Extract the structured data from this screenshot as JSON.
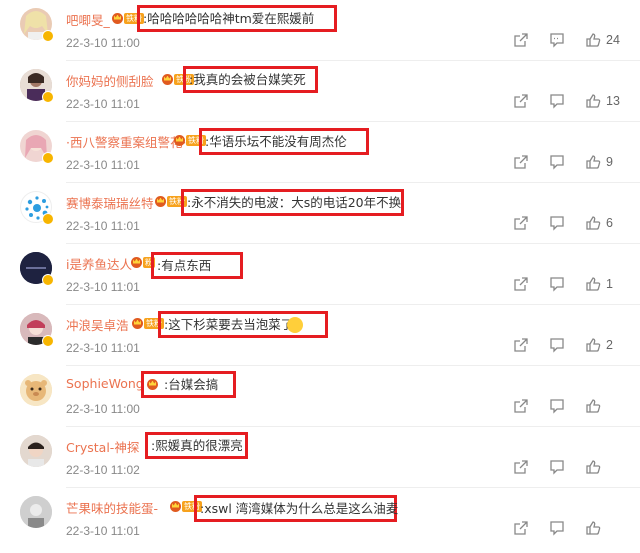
{
  "comments": [
    {
      "name": "吧唧旻_",
      "text": ":哈哈哈哈哈哈神tm爱在熙媛前",
      "time": "22-3-10 11:00",
      "likes": "24",
      "tag": "铁粉",
      "avatar_color": "#e9c2a6"
    },
    {
      "name": "你妈妈的侧刮脸",
      "text": ":我真的会被台媒笑死",
      "time": "22-3-10 11:01",
      "likes": "13",
      "tag": "铁粉",
      "avatar_color": "#b89a8a"
    },
    {
      "name": "·西八警察重案组警花·",
      "text": ":华语乐坛不能没有周杰伦",
      "time": "22-3-10 11:01",
      "likes": "9",
      "tag": "铁粉",
      "avatar_color": "#e7b3b0"
    },
    {
      "name": "赛博泰瑞瑞丝特",
      "text": ":永不消失的电波：大s的电话20年不换",
      "time": "22-3-10 11:01",
      "likes": "6",
      "tag": "铁粉",
      "avatar_color": "#ffffff"
    },
    {
      "name": "i是养鱼达人",
      "text": ":有点东西",
      "time": "22-3-10 11:01",
      "likes": "1",
      "tag": "粉",
      "avatar_color": "#1e2240"
    },
    {
      "name": "冲浪吴卓浩",
      "text": ":这下杉菜要去当泡菜了",
      "time": "22-3-10 11:01",
      "likes": "2",
      "tag": "铁粉",
      "avatar_color": "#c98a8e"
    },
    {
      "name": "SophieWong",
      "text": ":台媒会搞",
      "time": "22-3-10 11:00",
      "likes": "",
      "tag": "",
      "avatar_color": "#f2d9a6"
    },
    {
      "name": "Crystal-神探",
      "text": ":熙媛真的很漂亮",
      "time": "22-3-10 11:02",
      "likes": "",
      "tag": "",
      "avatar_color": "#d9c8bd"
    },
    {
      "name": "芒果味的技能蛋-",
      "text": ":xswl 湾湾媒体为什么总是这么油麦",
      "time": "22-3-10 11:01",
      "likes": "",
      "tag": "铁粉",
      "avatar_color": "#d8d8d8"
    }
  ]
}
